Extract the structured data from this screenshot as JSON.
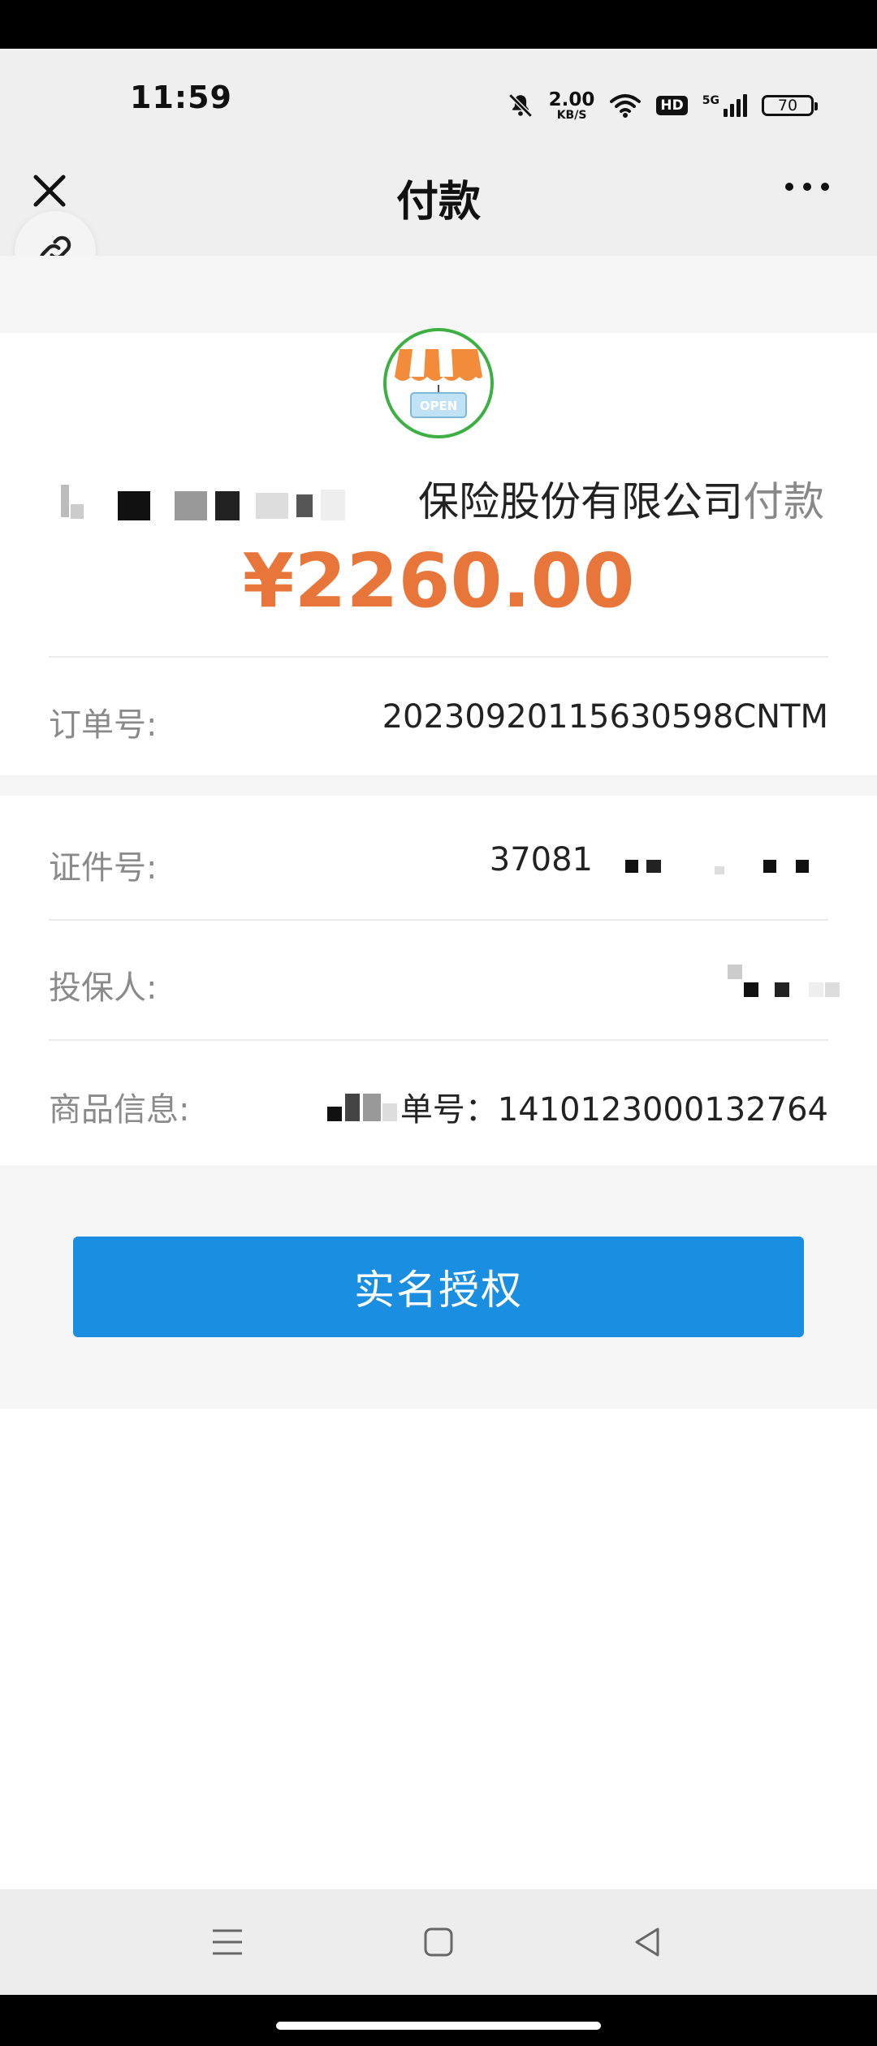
{
  "status_bar": {
    "time": "11:59",
    "net_speed": "2.00",
    "net_speed_unit": "KB/S",
    "hd_label": "HD",
    "signal_label": "5G",
    "battery": "70"
  },
  "nav": {
    "title": "付款"
  },
  "payment": {
    "merchant_suffix_company": "保险股份有限公司",
    "merchant_suffix_action": "付款",
    "amount": "¥2260.00",
    "order_label": "订单号:",
    "order_value": "20230920115630598CNTM"
  },
  "details": {
    "id_label": "证件号:",
    "id_value_prefix": "37081",
    "policyholder_label": "投保人:",
    "product_label": "商品信息:",
    "product_value": "单号：1410123000132764"
  },
  "action": {
    "button_label": "实名授权"
  },
  "colors": {
    "accent_blue": "#1a8ee0",
    "amount_orange": "#e8763a"
  }
}
